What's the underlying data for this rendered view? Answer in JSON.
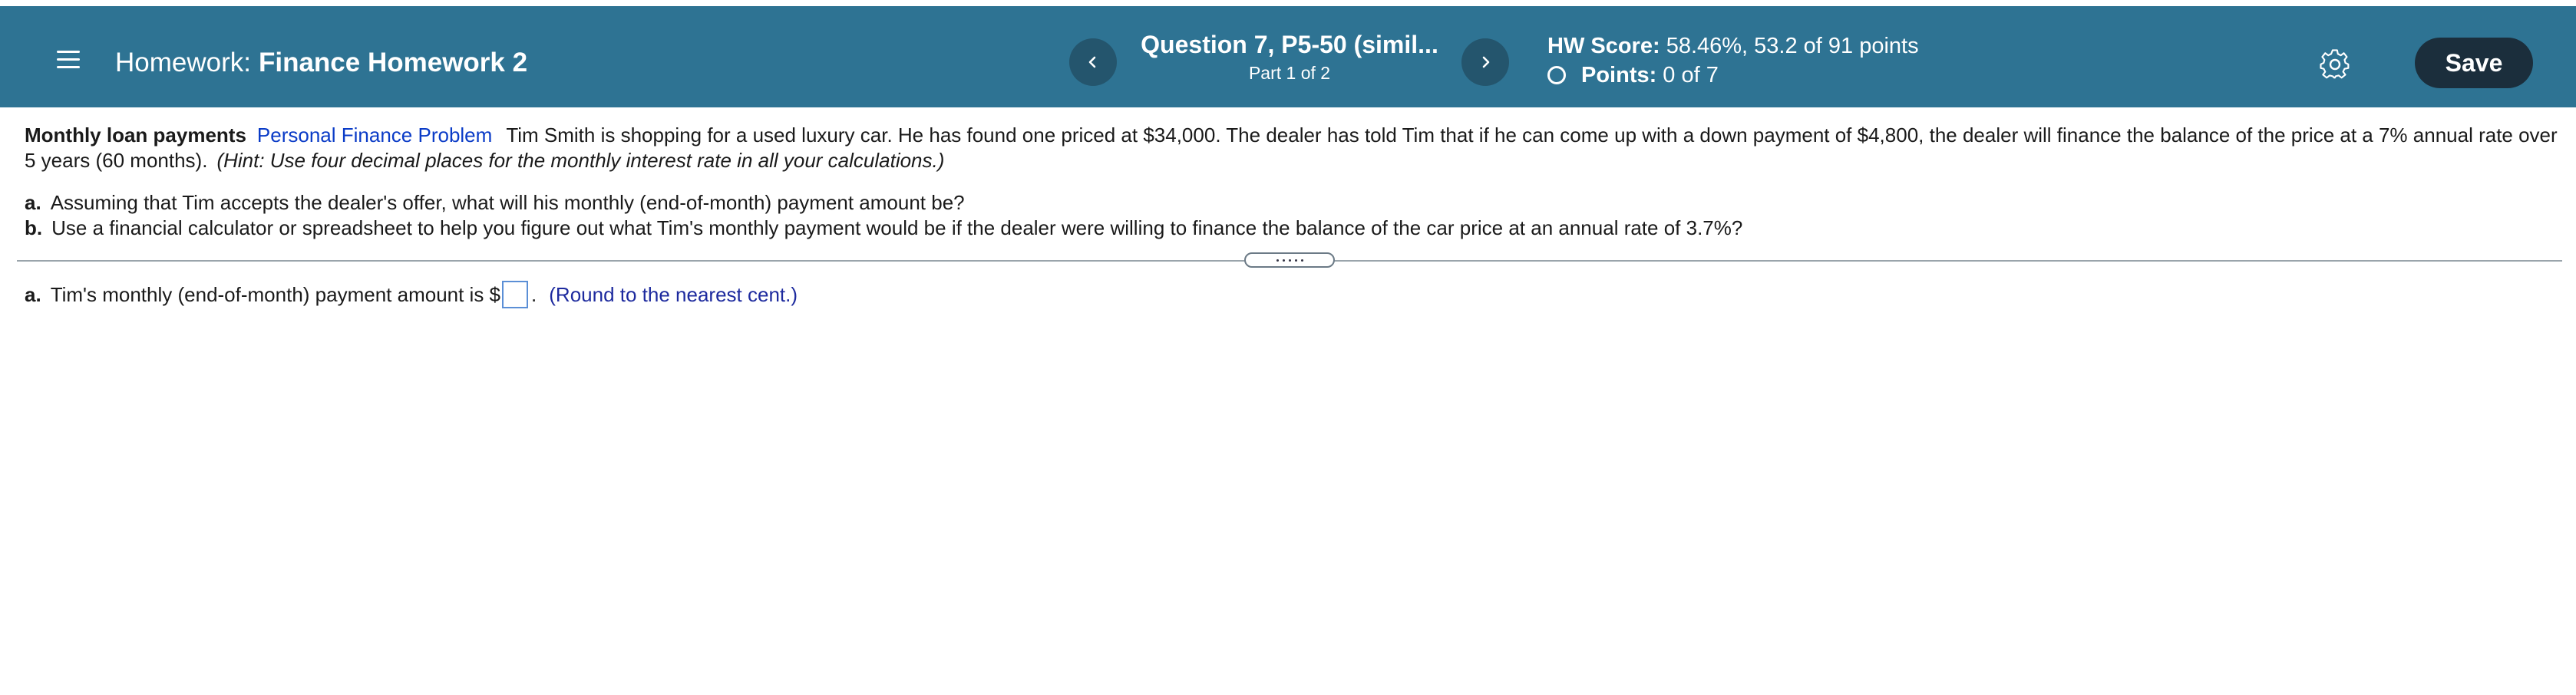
{
  "header": {
    "menu_icon": "hamburger-menu-icon",
    "title_prefix": "Homework:",
    "title_name": "Finance Homework 2",
    "question_title": "Question 7, P5-50 (simil...",
    "question_part": "Part 1 of 2",
    "prev_icon": "chevron-left-icon",
    "next_icon": "chevron-right-icon",
    "hw_score_label": "HW Score:",
    "hw_score_value": "58.46%, 53.2 of 91 points",
    "points_label": "Points:",
    "points_value": "0 of 7",
    "settings_icon": "gear-icon",
    "save_label": "Save",
    "bar_color": "#2e7393"
  },
  "problem": {
    "heading": "Monthly loan payments",
    "link": "Personal Finance Problem",
    "body": "Tim Smith is shopping for a used luxury car.  He has found one priced at $34,000.  The dealer has told Tim that if he can come up with a down payment of $4,800, the dealer will finance the balance of the price at a 7% annual rate over 5 years (60 months).",
    "hint": "(Hint: Use four decimal places for the monthly interest rate in all your calculations.)",
    "parts": [
      {
        "label": "a.",
        "text": "Assuming that Tim accepts the dealer's offer, what will his monthly (end-of-month) payment amount be?"
      },
      {
        "label": "b.",
        "text": "Use a financial calculator or spreadsheet to help you figure out what Tim's monthly payment would be if the dealer were willing to finance the balance of the car price at an annual rate of 3.7%?"
      }
    ]
  },
  "answer": {
    "label": "a.",
    "text_before": "Tim's monthly (end-of-month) payment amount is $",
    "text_after": ".",
    "instruction": "(Round to the nearest cent.)",
    "value": ""
  }
}
